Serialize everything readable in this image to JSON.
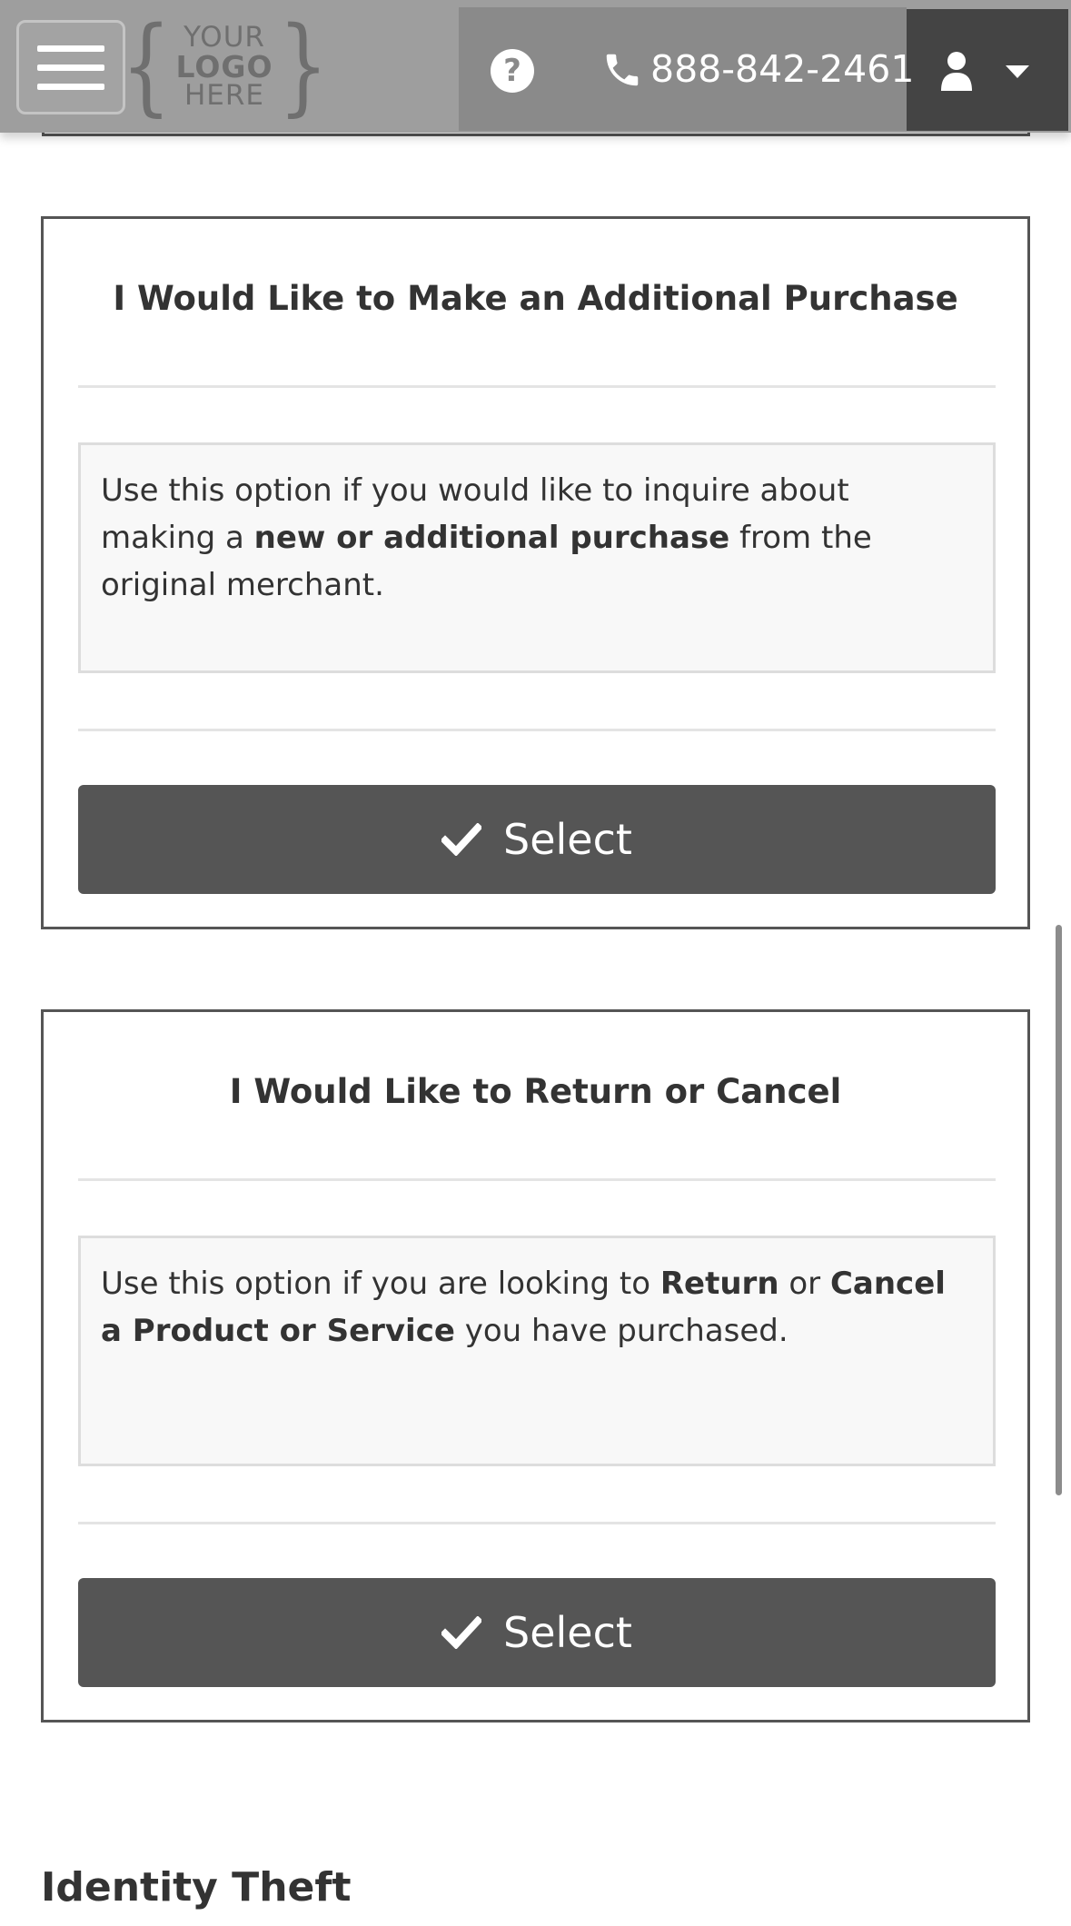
{
  "header": {
    "logo": {
      "line1": "YOUR",
      "line2": "LOGO",
      "line3": "HERE",
      "brace_open": "{",
      "brace_close": "}"
    },
    "help_glyph": "?",
    "phone": "888-842-2461",
    "icons": [
      "hamburger-menu-icon",
      "question-circle-icon",
      "phone-icon",
      "user-icon",
      "caret-down-icon"
    ]
  },
  "cards": [
    {
      "title": "I Would Like to Make an Additional Purchase",
      "desc_parts": [
        "Use this option if you would like to inquire about making a ",
        "new or additional purchase",
        " from the original merchant."
      ],
      "button_label": "Select"
    },
    {
      "title": "I Would Like to Return or Cancel",
      "desc_parts": [
        "Use this option if you are looking to ",
        "Return",
        " or ",
        "Cancel a Product or Service",
        " you have purchased."
      ],
      "button_label": "Select"
    }
  ],
  "section_heading": "Identity Theft",
  "colors": {
    "header_bg": "#9e9e9e",
    "help_phone_bg": "#8a8a8a",
    "user_menu_bg": "#444444",
    "button_bg": "#555555",
    "card_border": "#555555",
    "desc_bg": "#f8f8f8"
  }
}
